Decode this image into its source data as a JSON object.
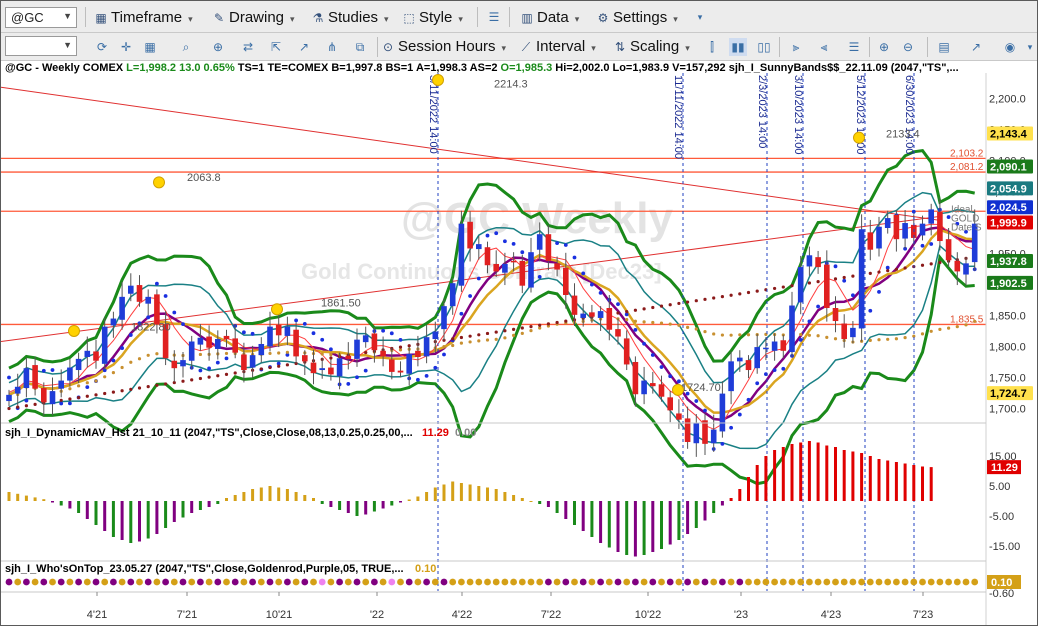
{
  "toolbar": {
    "symbol": "@GC",
    "items": [
      {
        "name": "timeframe",
        "label": "Timeframe",
        "icon": "calendar-icon"
      },
      {
        "name": "drawing",
        "label": "Drawing",
        "icon": "pencil-icon"
      },
      {
        "name": "studies",
        "label": "Studies",
        "icon": "flask-icon"
      },
      {
        "name": "style",
        "label": "Style",
        "icon": "style-icon"
      },
      {
        "name": "data",
        "label": "Data",
        "icon": "data-icon"
      },
      {
        "name": "settings",
        "label": "Settings",
        "icon": "gear-icon"
      }
    ],
    "row2": [
      {
        "name": "session-hours",
        "label": "Session Hours",
        "icon": "session-icon"
      },
      {
        "name": "interval",
        "label": "Interval",
        "icon": "interval-icon"
      },
      {
        "name": "scaling",
        "label": "Scaling",
        "icon": "scaling-icon"
      }
    ]
  },
  "chart_header": {
    "symbol": "@GC - Weekly",
    "exchange": "COMEX",
    "stats": [
      {
        "text": "L=1,998.2",
        "color": "#1a8a1a"
      },
      {
        "text": "13.0",
        "color": "#1a8a1a"
      },
      {
        "text": "0.65%",
        "color": "#1a8a1a"
      },
      {
        "text": "TS=1",
        "color": "#000000"
      },
      {
        "text": "TE=COMEX",
        "color": "#000000"
      },
      {
        "text": "B=1,997.8",
        "color": "#000000"
      },
      {
        "text": "BS=1",
        "color": "#000000"
      },
      {
        "text": "A=1,998.3",
        "color": "#000000"
      },
      {
        "text": "AS=2",
        "color": "#000000"
      },
      {
        "text": "O=1,985.3",
        "color": "#1a8a1a"
      },
      {
        "text": "Hi=2,002.0",
        "color": "#000000"
      },
      {
        "text": "Lo=1,983.9",
        "color": "#000000"
      },
      {
        "text": "V=157,292",
        "color": "#000000"
      },
      {
        "text": "sjh_I_SunnyBands$$_22.11.09 (2047,\"TS\",...",
        "color": "#000000"
      }
    ],
    "watermark": "@GC Weekly",
    "watermark2": "Gold Continuous Contract [Dec23]"
  },
  "chart_data": {
    "type": "candlestick",
    "x_ticks": [
      "4'21",
      "7'21",
      "10'21",
      "'22",
      "4'22",
      "7'22",
      "10'22",
      "'23",
      "4'23",
      "7'23"
    ],
    "price_axis_ticks": [
      "2,200.0",
      "2,150.0",
      "2,100.0",
      "2,050.0",
      "2,000.0",
      "1,950.0",
      "1,900.0",
      "1,850.0",
      "1,800.0",
      "1,750.0",
      "1,700.0"
    ],
    "ylim": [
      1675,
      2228
    ],
    "close_series": [
      1722,
      1735,
      1765,
      1732,
      1710,
      1728,
      1745,
      1766,
      1780,
      1793,
      1777,
      1832,
      1845,
      1880,
      1898,
      1872,
      1880,
      1836,
      1781,
      1765,
      1778,
      1808,
      1814,
      1798,
      1812,
      1812,
      1790,
      1762,
      1786,
      1804,
      1832,
      1818,
      1832,
      1784,
      1776,
      1757,
      1765,
      1755,
      1781,
      1780,
      1811,
      1818,
      1794,
      1784,
      1759,
      1758,
      1788,
      1783,
      1815,
      1824,
      1865,
      1902,
      1998,
      1958,
      1965,
      1931,
      1921,
      1933,
      1937,
      1898,
      1952,
      1981,
      1938,
      1924,
      1883,
      1851,
      1853,
      1848,
      1857,
      1827,
      1816,
      1771,
      1723,
      1745,
      1736,
      1719,
      1697,
      1682,
      1646,
      1676,
      1643,
      1666,
      1724,
      1776,
      1782,
      1762,
      1799,
      1798,
      1808,
      1793,
      1866,
      1928,
      1947,
      1928,
      1862,
      1841,
      1812,
      1830,
      1989,
      1956,
      1993,
      2007,
      1973,
      1999,
      1975,
      1998,
      2021,
      1970,
      1939,
      1921,
      1934,
      1998
    ],
    "price_labels": [
      {
        "text": "2214.3",
        "value": 2214.3
      },
      {
        "text": "2063.8",
        "value": 2063.8
      },
      {
        "text": "1822.80",
        "value": 1822.8
      },
      {
        "text": "1861.50",
        "value": 1861.5
      },
      {
        "text": "1724.70",
        "value": 1724.7
      },
      {
        "text": "2133.4",
        "value": 2133.4
      }
    ],
    "horizontal_levels": [
      {
        "value": 2103.2,
        "label": "2,103.2"
      },
      {
        "value": 2081.2,
        "label": "2,081.2"
      },
      {
        "value": 2018.0,
        "label": ""
      },
      {
        "value": 1835.5,
        "label": "1,835.5"
      }
    ],
    "vertical_markers": [
      {
        "label": "3/11/2022 14:00"
      },
      {
        "label": "11/11/2022 14:00"
      },
      {
        "label": "2/3/2023 14:00"
      },
      {
        "label": "3/10/2023 14:00"
      },
      {
        "label": "5/12/2023 14:00"
      },
      {
        "label": "6/30/2023 14:00"
      }
    ],
    "axis_tags": [
      {
        "text": "2,143.4",
        "bg": "#ffe14d",
        "fg": "#000000"
      },
      {
        "text": "2,090.1",
        "bg": "#1a7a1a",
        "fg": "#ffffff"
      },
      {
        "text": "2,054.9",
        "bg": "#1a7a80",
        "fg": "#ffffff"
      },
      {
        "text": "2,024.5",
        "bg": "#1030d0",
        "fg": "#ffffff"
      },
      {
        "text": "1,999.9",
        "bg": "#e00000",
        "fg": "#ffffff"
      },
      {
        "text": "1,937.8",
        "bg": "#1a7a1a",
        "fg": "#ffffff"
      },
      {
        "text": "1,902.5",
        "bg": "#1a7a1a",
        "fg": "#ffffff"
      },
      {
        "text": "1,724.7",
        "bg": "#ffe14d",
        "fg": "#000000"
      }
    ],
    "overlay_notes": [
      "Ideal",
      "GOLD",
      "Date S"
    ],
    "histogram": {
      "title": "sjh_I_DynamicMAV_Hst 21_10_11 (2047,\"TS\",Close,Close,08,13,0.25,0.25,00,...",
      "value_text": "11.29",
      "value2_text": "0.00",
      "axis_ticks": [
        "15.00",
        "5.00",
        "-5.00",
        "-15.00"
      ],
      "ylim": [
        -20,
        20
      ],
      "values": [
        3,
        2.4,
        1.8,
        1.2,
        0.6,
        -0.5,
        -1.5,
        -2.5,
        -4,
        -6,
        -8,
        -10,
        -12,
        -13,
        -14,
        -13.5,
        -12.5,
        -11,
        -9,
        -7,
        -5.5,
        -4,
        -3,
        -2,
        -1,
        1,
        2,
        3,
        4,
        4.5,
        5,
        4.5,
        4,
        3,
        2,
        1,
        -1,
        -2,
        -3,
        -4,
        -5,
        -4.5,
        -3.5,
        -2.5,
        -1.5,
        -0.5,
        0.5,
        1.5,
        3,
        4.5,
        5.5,
        6.5,
        6,
        5.5,
        5,
        4.5,
        4,
        3,
        2,
        1,
        0,
        -1,
        -2,
        -4,
        -6,
        -8,
        -10,
        -12,
        -14,
        -15.5,
        -17,
        -18,
        -18.5,
        -18,
        -17,
        -16,
        -14.5,
        -13,
        -11,
        -9,
        -6.5,
        -4,
        -1.5,
        1,
        4,
        8,
        12,
        15,
        17,
        18,
        19,
        19.5,
        20,
        19.5,
        18.5,
        18,
        17,
        16.5,
        16,
        15,
        14,
        13.5,
        13,
        12.5,
        12,
        11.5,
        11.3
      ],
      "tag": {
        "text": "11.29",
        "bg": "#e00000",
        "fg": "#ffffff"
      }
    },
    "ribbon": {
      "title": "sjh_I_Who'sOnTop_23.05.27 (2047,\"TS\",Close,Goldenrod,Purple,05, TRUE,...",
      "value_text": "0.10",
      "axis_ticks": [
        "-0.60"
      ],
      "colors": [
        "#d4a017",
        "#800080",
        "#ee82ee"
      ],
      "tag": {
        "text": "0.10",
        "bg": "#d4a017",
        "fg": "#ffffff"
      }
    }
  }
}
